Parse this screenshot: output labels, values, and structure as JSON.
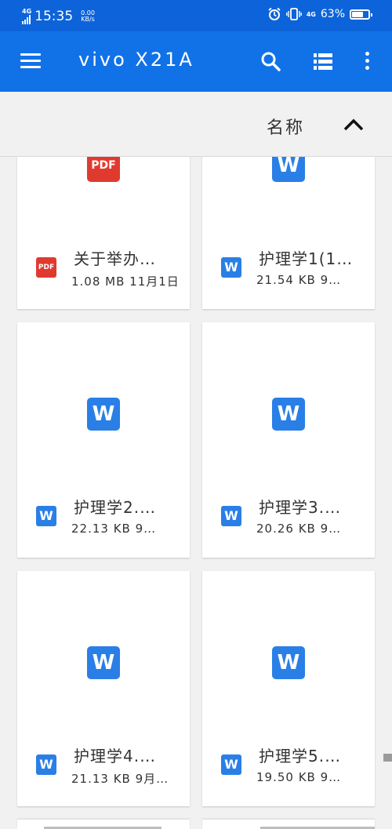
{
  "status_bar": {
    "network": "4G",
    "time": "15:35",
    "speed_value": "0.00",
    "speed_unit": "KB/s",
    "network_right": "4G",
    "battery": "63%",
    "battery_level": 0.63
  },
  "app_bar": {
    "title": "vivo  X21A",
    "icons": [
      "menu-icon",
      "search-icon",
      "list-view-icon",
      "more-vert-icon"
    ]
  },
  "sort_bar": {
    "label": "名称",
    "direction_icon": "chevron-up-icon"
  },
  "files": [
    {
      "type": "pdf",
      "icon_text": "PDF",
      "name": "关于举办…",
      "meta": "1.08 MB 11月1日"
    },
    {
      "type": "word",
      "icon_text": "W",
      "name": "护理学1(1…",
      "meta": "21.54 KB 9…"
    },
    {
      "type": "word",
      "icon_text": "W",
      "name": "护理学2.…",
      "meta": "22.13 KB 9…"
    },
    {
      "type": "word",
      "icon_text": "W",
      "name": "护理学3.…",
      "meta": "20.26 KB 9…"
    },
    {
      "type": "word",
      "icon_text": "W",
      "name": "护理学4.…",
      "meta": "21.13 KB 9月…"
    },
    {
      "type": "word",
      "icon_text": "W",
      "name": "护理学5.…",
      "meta": "19.50 KB 9…"
    }
  ],
  "colors": {
    "status_bar": "#0d63d9",
    "app_bar": "#1172e8",
    "word": "#2a7fe6",
    "pdf": "#e03a2f"
  }
}
